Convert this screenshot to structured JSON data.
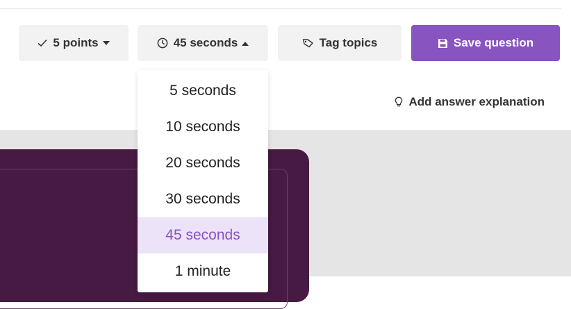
{
  "toolbar": {
    "points": {
      "label": "5 points",
      "icon": "check-icon"
    },
    "time": {
      "label": "45 seconds",
      "icon": "clock-icon"
    },
    "tag": {
      "label": "Tag topics",
      "icon": "tag-icon"
    },
    "save": {
      "label": "Save question",
      "icon": "floppy-disk-icon"
    }
  },
  "explanation": {
    "label": "Add answer explanation",
    "icon": "lightbulb-icon"
  },
  "time_dropdown": {
    "options": [
      "5 seconds",
      "10 seconds",
      "20 seconds",
      "30 seconds",
      "45 seconds",
      "1 minute"
    ],
    "selected": "45 seconds"
  },
  "colors": {
    "accent": "#8854c0",
    "accent_tint": "#ede3f8",
    "card": "#461a42",
    "canvas": "#e5e5e5",
    "button_bg": "#f2f2f2"
  }
}
